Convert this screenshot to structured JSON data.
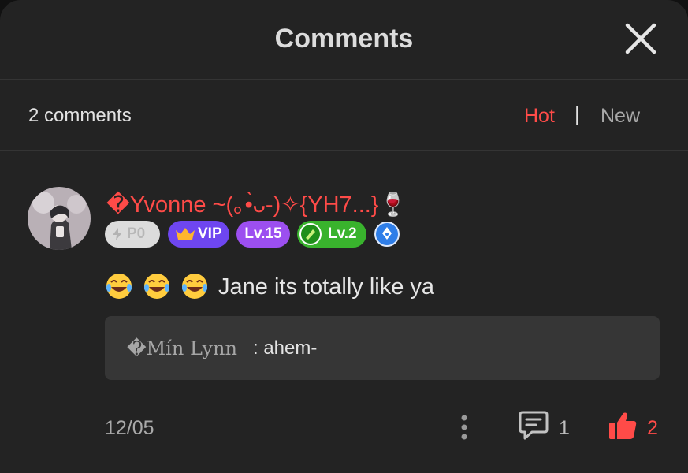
{
  "header": {
    "title": "Comments"
  },
  "summary": {
    "count_label": "2 comments",
    "sort": {
      "hot": "Hot",
      "separator": "|",
      "new": "New",
      "active": "Hot"
    }
  },
  "comment": {
    "username": "�Yvonne ~(｡•̀ᴗ-)✧{YH7...}🍷",
    "badges": [
      {
        "label": "P0",
        "icon": "lightning-icon"
      },
      {
        "label": "VIP",
        "icon": "crown-icon"
      },
      {
        "label": "Lv.15"
      },
      {
        "label": "Lv.2",
        "icon": "pen-icon"
      },
      {
        "label": "",
        "icon": "blue-pen-nib-icon"
      }
    ],
    "text": "Jane its totally like ya",
    "emoji_count": 3,
    "reply_preview": {
      "name": "�Mín Lynn",
      "text": ": ahem-"
    },
    "date": "12/05",
    "reply_count": "1",
    "like_count": "2"
  },
  "colors": {
    "background": "#232323",
    "accent_red": "#ff4b48",
    "divider": "#343434",
    "reply_box": "#363636",
    "vip_purple": "#6e46f0",
    "level_purple": "#9c4ff0",
    "level_green": "#39b32d",
    "badge_blue": "#2f7ee8"
  }
}
